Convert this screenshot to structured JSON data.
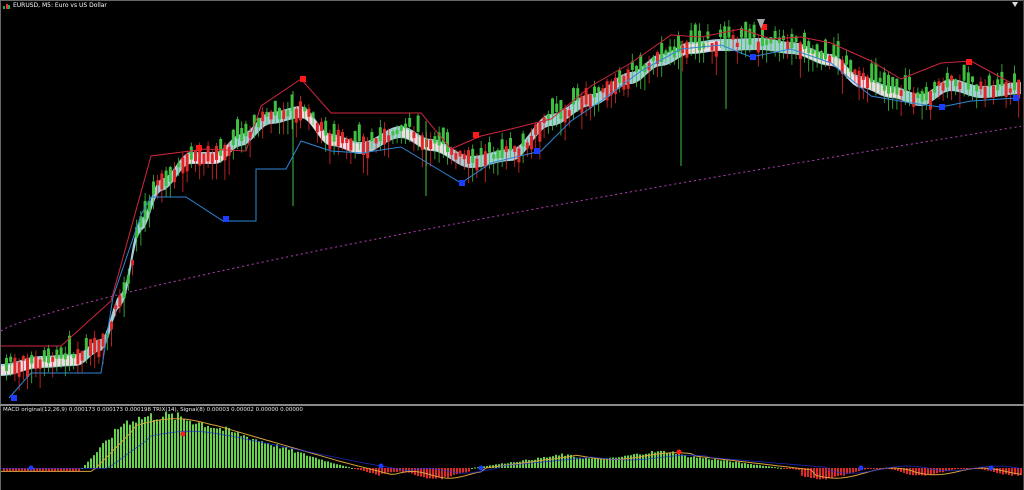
{
  "window": {
    "title": "EURUSD, M5:  Euro vs US Dollar",
    "symbol_icon": "chart-symbol-icon",
    "corner_icon": "triangle-icon"
  },
  "subwindow": {
    "label": "MACD original(12,26,9) 0.000173 0.000173 0.000198 TRIX(14), Signal(8) 0.00003 0.00002 0.00000 0.00000"
  },
  "colors": {
    "background": "#000000",
    "bull_candle": "#3fbf3f",
    "bear_candle": "#e02828",
    "ribbon_light": "#b7e6ef",
    "ribbon_pink": "#f3dce8",
    "ribbon_mid": "#d28fe8",
    "resistance_line": "#d0263f",
    "support_line": "#2f86d6",
    "long_ma": "#b83fb8",
    "macd_up": "#66d14b",
    "macd_down": "#e02828",
    "signal_line": "#d9a23a",
    "trix_line": "#2030e0",
    "marker_red": "#ff1a1a",
    "marker_blue": "#1a3dff"
  }
}
